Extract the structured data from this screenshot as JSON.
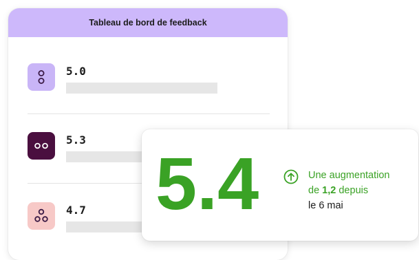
{
  "dashboard": {
    "title": "Tableau de bord de feedback",
    "rows": [
      {
        "value": "5.0",
        "icon": "two-dots-vertical-icon",
        "icon_bg": "#c9b5f7",
        "icon_fg": "#3b1a45"
      },
      {
        "value": "5.3",
        "icon": "two-dots-horizontal-icon",
        "icon_bg": "#4a0f3f",
        "icon_fg": "#ffffff"
      },
      {
        "value": "4.7",
        "icon": "three-dots-icon",
        "icon_bg": "#f7c9c7",
        "icon_fg": "#3b1a45"
      }
    ]
  },
  "highlight": {
    "score": "5.4",
    "trend_icon": "arrow-up-circle-icon",
    "trend_prefix": "Une augmentation",
    "trend_de": "de ",
    "trend_amount": "1,2",
    "trend_depuis": " depuis",
    "trend_date": "le 6 mai",
    "accent_color": "#3aa225",
    "accent_light": "#86c441"
  }
}
